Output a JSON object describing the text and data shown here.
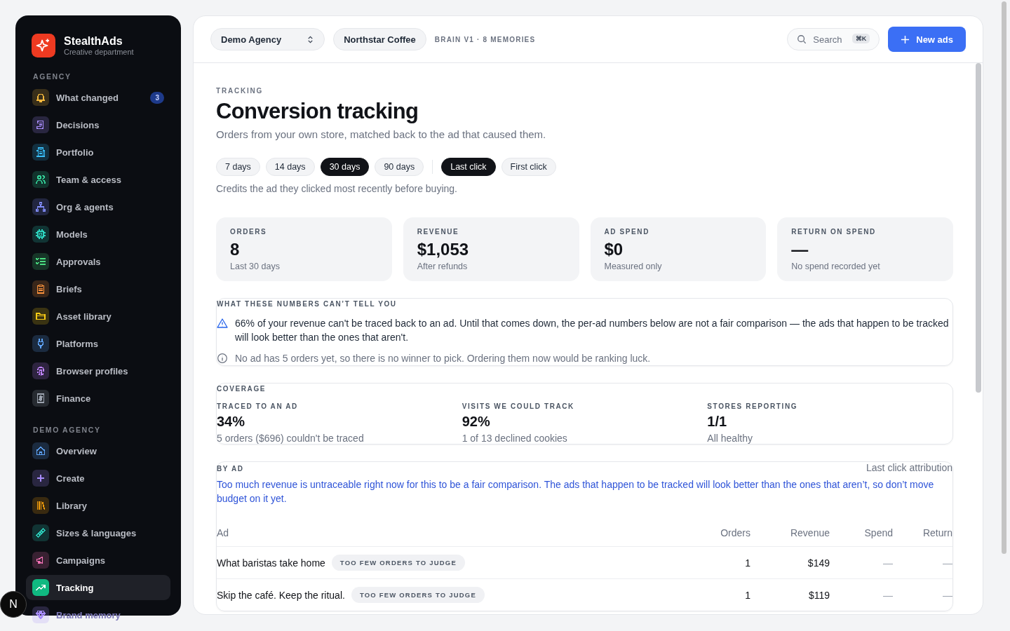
{
  "sidebar": {
    "brand": {
      "name": "StealthAds",
      "subtitle": "Creative department"
    },
    "sections": [
      {
        "title": "AGENCY",
        "items": [
          {
            "label": "What changed",
            "color": "#f5b83d",
            "selected": false,
            "badge": "3"
          },
          {
            "label": "Decisions",
            "color": "#a78bfa",
            "selected": false
          },
          {
            "label": "Portfolio",
            "color": "#38bdf8",
            "selected": false
          },
          {
            "label": "Team & access",
            "color": "#34d399",
            "selected": false
          },
          {
            "label": "Org & agents",
            "color": "#818cf8",
            "selected": false
          },
          {
            "label": "Models",
            "color": "#2dd4bf",
            "selected": false
          },
          {
            "label": "Approvals",
            "color": "#4ade80",
            "selected": false
          },
          {
            "label": "Briefs",
            "color": "#fb923c",
            "selected": false
          },
          {
            "label": "Asset library",
            "color": "#facc15",
            "selected": false
          },
          {
            "label": "Platforms",
            "color": "#60a5fa",
            "selected": false
          },
          {
            "label": "Browser profiles",
            "color": "#c084fc",
            "selected": false
          },
          {
            "label": "Finance",
            "color": "#9ca3af",
            "selected": false
          }
        ]
      },
      {
        "title": "DEMO AGENCY",
        "items": [
          {
            "label": "Overview",
            "color": "#60a5fa",
            "selected": false
          },
          {
            "label": "Create",
            "color": "#a78bfa",
            "selected": false
          },
          {
            "label": "Library",
            "color": "#f59e0b",
            "selected": false
          },
          {
            "label": "Sizes & languages",
            "color": "#2dd4bf",
            "selected": false
          },
          {
            "label": "Campaigns",
            "color": "#f472b6",
            "selected": false
          },
          {
            "label": "Tracking",
            "color": "#10b981",
            "selected": true
          },
          {
            "label": "Brand memory",
            "color": "#a78bfa",
            "selected": false
          }
        ]
      }
    ]
  },
  "header": {
    "agency": "Demo Agency",
    "client": "Northstar Coffee",
    "brain": "BRAIN V1 · 8 MEMORIES",
    "search": {
      "placeholder": "Search",
      "shortcut": "⌘K"
    },
    "new_button": "New ads"
  },
  "page": {
    "eyebrow": "TRACKING",
    "title": "Conversion tracking",
    "subtitle": "Orders from your own store, matched back to the ad that caused them.",
    "ranges": [
      {
        "label": "7 days",
        "selected": false
      },
      {
        "label": "14 days",
        "selected": false
      },
      {
        "label": "30 days",
        "selected": true
      },
      {
        "label": "90 days",
        "selected": false
      }
    ],
    "models": [
      {
        "label": "Last click",
        "selected": true
      },
      {
        "label": "First click",
        "selected": false
      }
    ],
    "model_note": "Credits the ad they clicked most recently before buying."
  },
  "stats": [
    {
      "label": "ORDERS",
      "value": "8",
      "note": "Last 30 days"
    },
    {
      "label": "REVENUE",
      "value": "$1,053",
      "note": "After refunds"
    },
    {
      "label": "AD SPEND",
      "value": "$0",
      "note": "Measured only"
    },
    {
      "label": "RETURN ON SPEND",
      "value": "—",
      "note": "No spend recorded yet"
    }
  ],
  "caveats": {
    "title": "WHAT THESE NUMBERS CAN’T TELL YOU",
    "items": [
      {
        "kind": "warning",
        "text": "66% of your revenue can't be traced back to an ad. Until that comes down, the per-ad numbers below are not a fair comparison — the ads that happen to be tracked will look better than the ones that aren't."
      },
      {
        "kind": "info",
        "text": "No ad has 5 orders yet, so there is no winner to pick. Ordering them now would be ranking luck."
      }
    ]
  },
  "coverage": {
    "title": "COVERAGE",
    "metrics": [
      {
        "label": "TRACED TO AN AD",
        "value": "34%",
        "note": "5 orders ($696) couldn't be traced"
      },
      {
        "label": "VISITS WE COULD TRACK",
        "value": "92%",
        "note": "1 of 13 declined cookies"
      },
      {
        "label": "STORES REPORTING",
        "value": "1/1",
        "note": "All healthy"
      }
    ]
  },
  "by_ad": {
    "title": "BY AD",
    "attribution": "Last click attribution",
    "warning": "Too much revenue is untraceable right now for this to be a fair comparison. The ads that happen to be tracked will look better than the ones that aren’t, so don’t move budget on it yet.",
    "columns": [
      "Ad",
      "Orders",
      "Revenue",
      "Spend",
      "Return"
    ],
    "rows": [
      {
        "ad": "What baristas take home",
        "tag": "TOO FEW ORDERS TO JUDGE",
        "orders": "1",
        "revenue": "$149",
        "spend": "—",
        "return": "—"
      },
      {
        "ad": "Skip the café. Keep the ritual.",
        "tag": "TOO FEW ORDERS TO JUDGE",
        "orders": "1",
        "revenue": "$119",
        "spend": "—",
        "return": "—"
      }
    ]
  },
  "dev_badge": "N"
}
